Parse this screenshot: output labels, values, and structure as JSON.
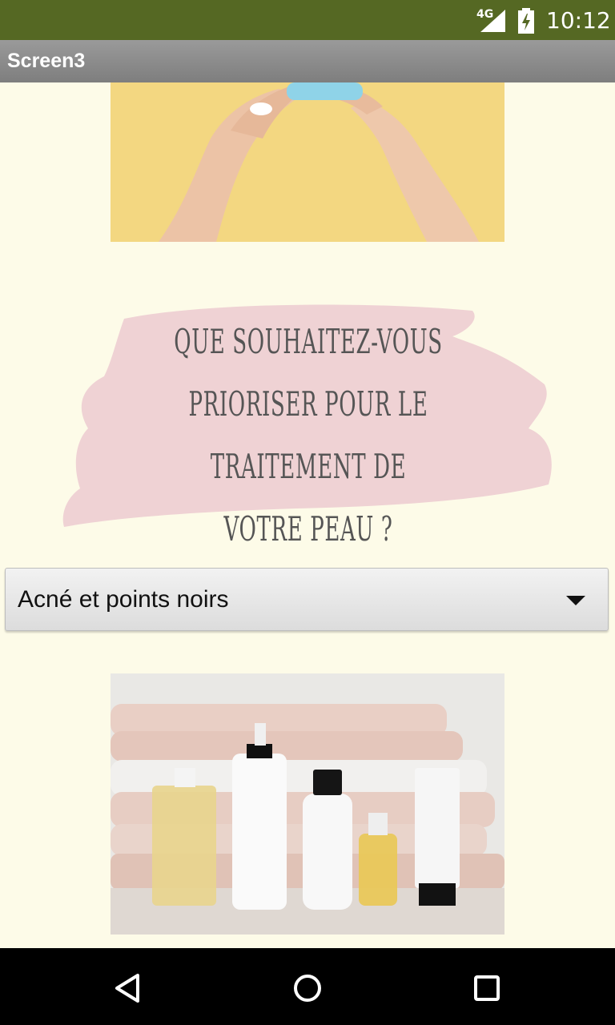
{
  "status_bar": {
    "network": "4G",
    "time": "10:12",
    "signal_icon": "signal-icon",
    "battery_icon": "battery-charging-icon"
  },
  "app_bar": {
    "title": "Screen3"
  },
  "question_card": {
    "text": "QUE SOUHAITEZ-VOUS\nPRIORISER POUR LE TRAITEMENT DE\nVOTRE PEAU ?",
    "brush_color": "#efd2d4"
  },
  "spinner": {
    "selected": "Acné et points noirs",
    "arrow_icon": "dropdown-arrow-icon"
  },
  "images": {
    "top": "hands-applying-cream-image",
    "bottom": "skincare-products-image"
  },
  "nav_bar": {
    "back_icon": "back-icon",
    "home_icon": "home-icon",
    "recents_icon": "recents-icon"
  },
  "colors": {
    "status_bar": "#556823",
    "background": "#fdfbe8",
    "app_bar": "#8a8a8a"
  }
}
